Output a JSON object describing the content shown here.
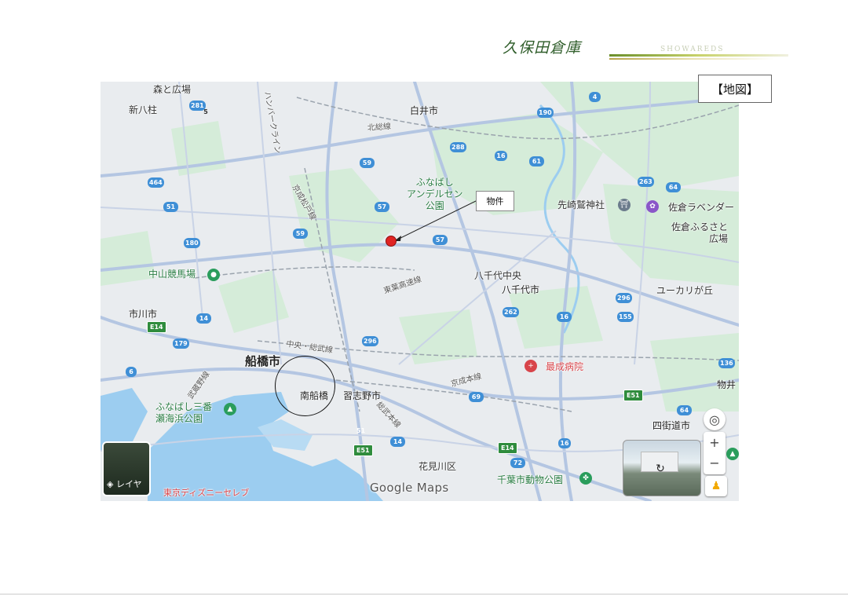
{
  "header": {
    "brand": "久保田倉庫",
    "brand_roman": "SHOWAREDS",
    "section_label": "【地図】"
  },
  "map": {
    "place_labels": {
      "shirai": "白井市",
      "funabashi_park": "ふなばし\nアンデルセン\n公園",
      "funabashi": "船橋市",
      "minami_funabashi": "南船橋",
      "narashino": "習志野市",
      "yachiyo": "八千代市",
      "yachiyo_chuo": "八千代中央",
      "ichikawa": "市川市",
      "nakayama": "中山競馬場",
      "morito_hiroba": "森と広場",
      "shinyahashira": "新八柱",
      "sakisaki": "先崎鷲神社",
      "sakura_lavender": "佐倉ラベンダー",
      "sakura_furusato": "佐倉ふるさと\n広場",
      "yukarigaoka": "ユーカリが丘",
      "saisei": "最成病院",
      "sanban": "ふなばし三番\n瀬海浜公園",
      "hanamigawa": "花見川区",
      "chiba_zoo": "千葉市動物公園",
      "yotsukaido": "四街道市",
      "monoi": "物井",
      "disney": "東京ディズニーセレブ"
    },
    "road_labels": {
      "hokuso": "北総線",
      "shinkeisei": "京成松戸線",
      "toyo": "東葉高速線",
      "sobu": "中央・総武線",
      "keisei": "京成本線",
      "musashino": "武蔵野線",
      "sobu_main": "総武本線",
      "sakura": "ハンバークライン"
    },
    "shields": [
      "281",
      "190",
      "4",
      "288",
      "59",
      "16",
      "61",
      "464",
      "51",
      "57",
      "263",
      "64",
      "180",
      "59",
      "57",
      "5",
      "296",
      "262",
      "14",
      "16",
      "155",
      "179",
      "296",
      "6",
      "136",
      "69",
      "14",
      "51",
      "72",
      "16",
      "64"
    ],
    "expressway_shields": [
      "E14",
      "E51",
      "E14",
      "E51"
    ],
    "property_callout": "物件",
    "layer_button": "レイヤ",
    "logo_text": "Google Maps",
    "zoom_in": "+",
    "zoom_out": "−"
  },
  "colors": {
    "water": "#9ccdf0",
    "land": "#e9ecef",
    "park": "#cfe8d4",
    "road_major": "#b4c6e2",
    "marker": "#e02424",
    "shield": "#3f8fd6",
    "expressway": "#2f8c3d"
  }
}
